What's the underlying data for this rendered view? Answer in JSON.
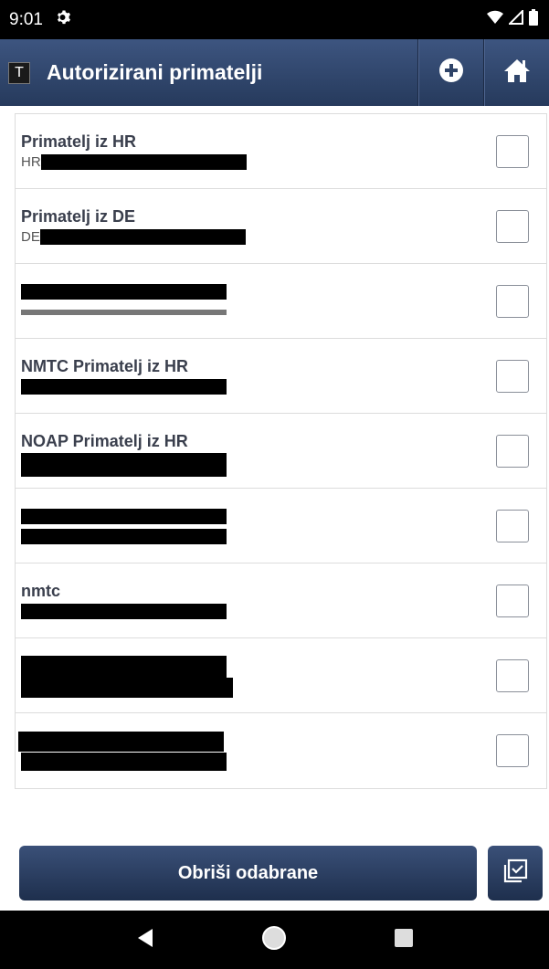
{
  "status_bar": {
    "time": "9:01"
  },
  "app_bar": {
    "logo_letter": "T",
    "title": "Autorizirani primatelji"
  },
  "recipients": [
    {
      "name": "Primatelj iz HR",
      "code_prefix": "HR"
    },
    {
      "name": "Primatelj iz DE",
      "code_prefix": "DE"
    },
    {
      "name": "",
      "code_prefix": ""
    },
    {
      "name": "NMTC Primatelj iz HR",
      "code_prefix": ""
    },
    {
      "name": "NOAP Primatelj iz HR",
      "code_prefix": ""
    },
    {
      "name": "",
      "code_prefix": ""
    },
    {
      "name": "nmtc",
      "code_prefix": ""
    },
    {
      "name": "",
      "code_prefix": ""
    },
    {
      "name": "",
      "code_prefix": ""
    }
  ],
  "actions": {
    "delete_selected": "Obriši odabrane"
  },
  "colors": {
    "appbar": "#2f4468",
    "button": "#2c4268",
    "text_primary": "#3a3f4d"
  },
  "icons": {
    "settings": "gear-icon",
    "wifi": "wifi-icon",
    "signal": "signal-icon",
    "battery": "battery-icon",
    "add": "plus-circle-icon",
    "home": "home-icon",
    "select_all": "select-all-icon",
    "back": "back-triangle-icon",
    "nav_home": "circle-home-icon",
    "recents": "square-recents-icon"
  }
}
